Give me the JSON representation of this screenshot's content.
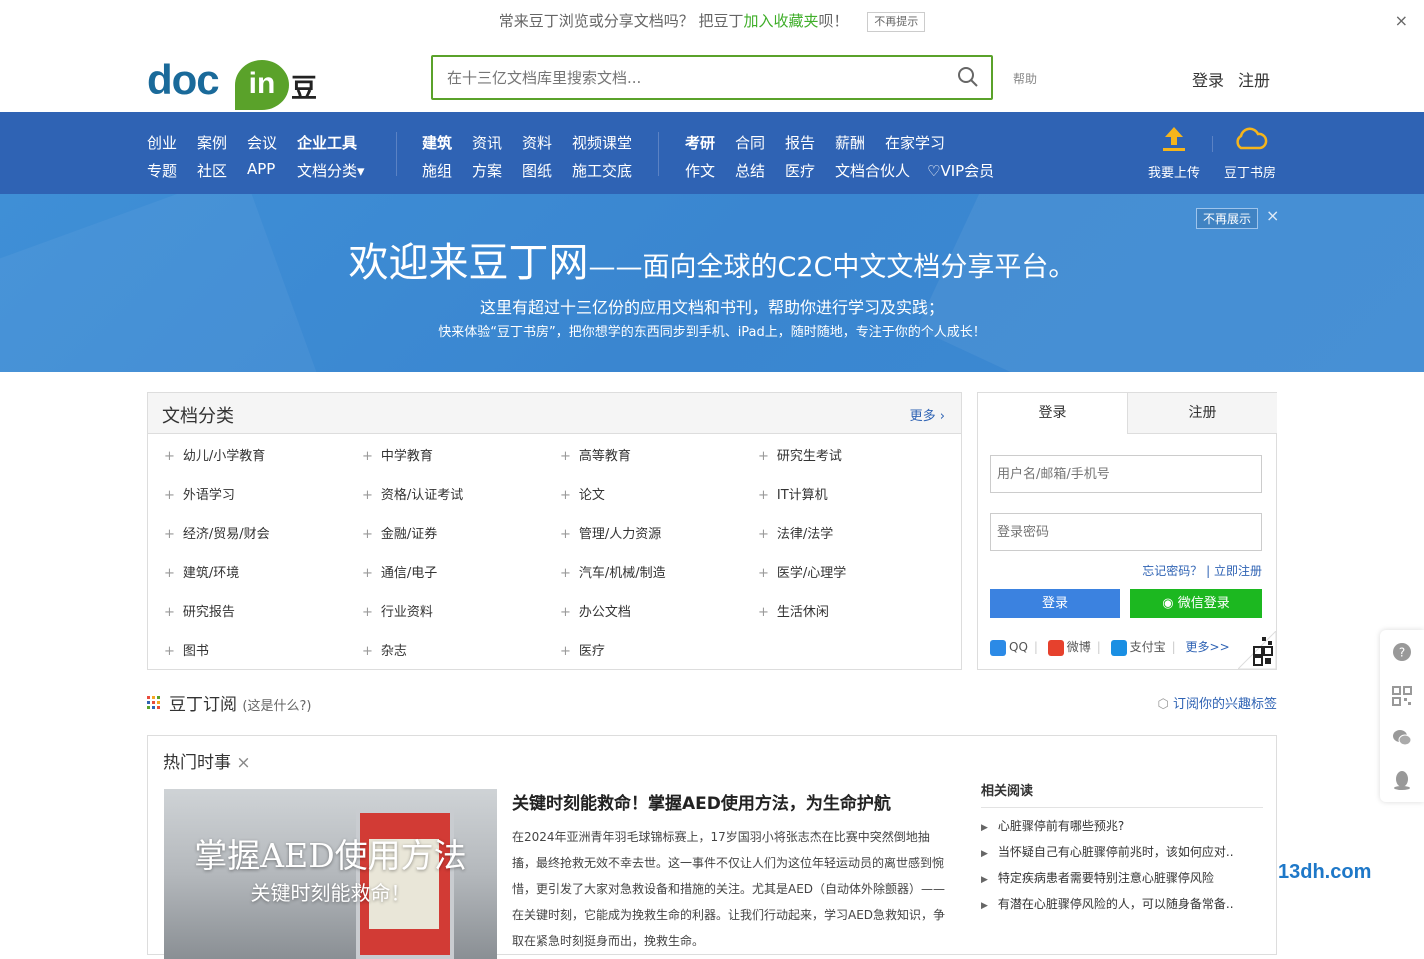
{
  "topbar": {
    "text_a": "常来豆丁浏览或分享文档吗？ 把豆丁",
    "text_link": "加入收藏夹",
    "text_b": "呗！",
    "dismiss": "不再提示",
    "close": "×"
  },
  "header": {
    "logo_doc": "doc",
    "logo_in": "in",
    "logo_cn": "豆丁",
    "search_placeholder": "在十三亿文档库里搜索文档...",
    "help": "帮助",
    "login": "登录",
    "register": "注册"
  },
  "nav": {
    "group1_row1": [
      "创业",
      "案例",
      "会议",
      "企业工具"
    ],
    "group1_row2": [
      "专题",
      "社区",
      "APP",
      "文档分类▾"
    ],
    "group2_row1": [
      "建筑",
      "资讯",
      "资料",
      "视频课堂"
    ],
    "group2_row2": [
      "施组",
      "方案",
      "图纸",
      "施工交底"
    ],
    "group3_row1": [
      "考研",
      "合同",
      "报告",
      "薪酬",
      "在家学习"
    ],
    "group3_row2": [
      "作文",
      "总结",
      "医疗",
      "文档合伙人",
      "♡VIP会员"
    ],
    "upload": "我要上传",
    "bookroom": "豆丁书房"
  },
  "banner": {
    "title_big": "欢迎来豆丁网",
    "title_small": "——面向全球的C2C中文文档分享平台。",
    "line1": "这里有超过十三亿份的应用文档和书刊，帮助你进行学习及实践；",
    "line2": "快来体验“豆丁书房”，把你想学的东西同步到手机、iPad上，随时随地，专注于你的个人成长！",
    "no_show": "不再展示",
    "close": "×"
  },
  "categories": {
    "title": "文档分类",
    "more": "更多 ›",
    "items": [
      [
        "幼儿/小学教育",
        "中学教育",
        "高等教育",
        "研究生考试"
      ],
      [
        "外语学习",
        "资格/认证考试",
        "论文",
        "IT计算机"
      ],
      [
        "经济/贸易/财会",
        "金融/证券",
        "管理/人力资源",
        "法律/法学"
      ],
      [
        "建筑/环境",
        "通信/电子",
        "汽车/机械/制造",
        "医学/心理学"
      ],
      [
        "研究报告",
        "行业资料",
        "办公文档",
        "生活休闲"
      ],
      [
        "图书",
        "杂志",
        "医疗",
        ""
      ]
    ]
  },
  "login_box": {
    "tab_login": "登录",
    "tab_register": "注册",
    "user_placeholder": "用户名/邮箱/手机号",
    "pass_placeholder": "登录密码",
    "forgot": "忘记密码？",
    "register_now": "| 立即注册",
    "login_btn": "登录",
    "wechat_btn": "微信登录",
    "qq": "QQ",
    "weibo": "微博",
    "alipay": "支付宝",
    "more": "更多>>"
  },
  "subscribe": {
    "title": "豆丁订阅",
    "what": "(这是什么?)",
    "tag": "订阅你的兴趣标签"
  },
  "hot": {
    "title": "热门时事",
    "close": "×",
    "img_cap1": "掌握AED使用方法",
    "img_cap2": "关键时刻能救命！",
    "article_title": "关键时刻能救命！掌握AED使用方法，为生命护航",
    "article_body": "在2024年亚洲青年羽毛球锦标赛上，17岁国羽小将张志杰在比赛中突然倒地抽搐，最终抢救无效不幸去世。这一事件不仅让人们为这位年轻运动员的离世感到惋惜，更引发了大家对急救设备和措施的关注。尤其是AED（自动体外除颤器）——在关键时刻，它能成为挽救生命的利器。让我们行动起来，学习AED急救知识，争取在紧急时刻挺身而出，挽救生命。",
    "related_title": "相关阅读",
    "related": [
      "心脏骤停前有哪些预兆?",
      "当怀疑自己有心脏骤停前兆时，该如何应对..",
      "特定疾病患者需要特别注意心脏骤停风险",
      "有潜在心脏骤停风险的人，可以随身备常备.."
    ]
  },
  "watermark": "13dh.com",
  "colors": {
    "nav_bg": "#2f63b4",
    "brand_green": "#5aa22a",
    "link_blue": "#2f63b4",
    "wechat_green": "#1cb820"
  }
}
